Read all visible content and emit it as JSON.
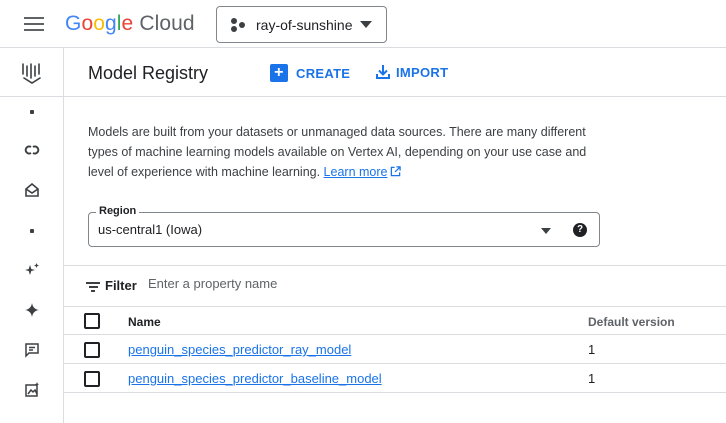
{
  "topbar": {
    "logo_google": [
      "G",
      "o",
      "o",
      "g",
      "l",
      "e"
    ],
    "logo_product": "Cloud",
    "project_name": "ray-of-sunshine"
  },
  "rail": {
    "icons": [
      "vertex-ai-icon",
      "dot-icon",
      "colab-icon",
      "model-garden-icon",
      "dot-icon",
      "sparkle-star-icon",
      "gemini-icon",
      "prompt-icon",
      "image-generation-icon"
    ]
  },
  "header": {
    "title": "Model Registry",
    "create_label": "CREATE",
    "import_label": "IMPORT"
  },
  "description": {
    "text": "Models are built from your datasets or unmanaged data sources. There are many different types of machine learning models available on Vertex AI, depending on your use case and level of experience with machine learning. ",
    "link_label": "Learn more"
  },
  "region": {
    "label": "Region",
    "value": "us-central1 (Iowa)",
    "help_glyph": "?"
  },
  "filter": {
    "label": "Filter",
    "placeholder": "Enter a property name"
  },
  "table": {
    "columns": {
      "name": "Name",
      "default_version": "Default version"
    },
    "rows": [
      {
        "name": "penguin_species_predictor_ray_model",
        "default_version": "1"
      },
      {
        "name": "penguin_species_predictor_baseline_model",
        "default_version": "1"
      }
    ]
  },
  "colors": {
    "accent": "#1a73e8",
    "border": "#dadce0",
    "text": "#202124"
  }
}
